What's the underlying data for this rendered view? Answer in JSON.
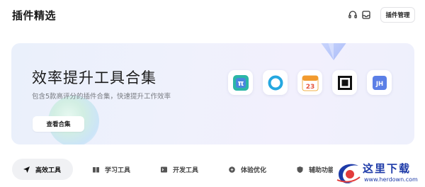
{
  "header": {
    "title": "插件精选",
    "manage_label": "插件管理",
    "icons": [
      "headset-icon",
      "inbox-icon"
    ]
  },
  "banner": {
    "title": "效率提升工具合集",
    "subtitle": "包含5款高评分的插件合集，快速提升工作效率",
    "button_label": "查看合集",
    "apps": [
      {
        "name": "math-app-icon",
        "label": "π"
      },
      {
        "name": "ring-app-icon",
        "label": ""
      },
      {
        "name": "calendar-app-icon",
        "label": "23"
      },
      {
        "name": "qr-square-app-icon",
        "label": ""
      },
      {
        "name": "jh-app-icon",
        "label": "JH"
      }
    ]
  },
  "tabs": [
    {
      "label": "高效工具",
      "icon": "send-icon",
      "active": true
    },
    {
      "label": "学习工具",
      "icon": "book-icon",
      "active": false
    },
    {
      "label": "开发工具",
      "icon": "code-icon",
      "active": false
    },
    {
      "label": "体验优化",
      "icon": "sparkle-icon",
      "active": false
    },
    {
      "label": "辅助功能",
      "icon": "shield-icon",
      "active": false
    }
  ],
  "watermark": {
    "text": "这里下载",
    "url": "www.herdown.com"
  },
  "colors": {
    "accent": "#1d3aa8",
    "banner_bg": "#eef1fc",
    "tab_active_bg": "#f0f1f4"
  }
}
